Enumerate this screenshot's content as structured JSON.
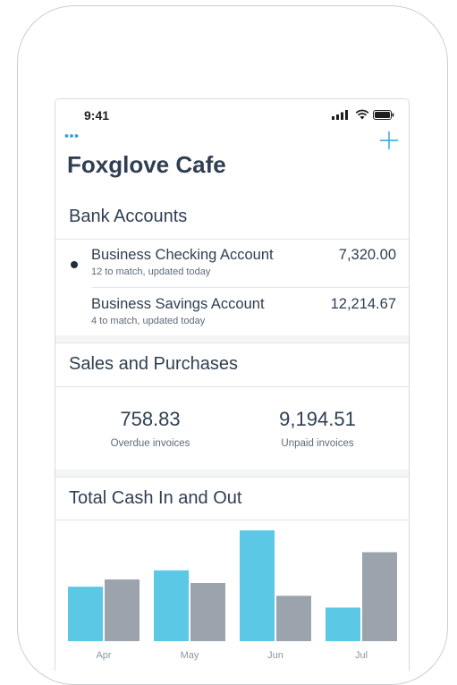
{
  "status_bar": {
    "time": "9:41"
  },
  "header": {
    "title": "Foxglove Cafe"
  },
  "bank_accounts": {
    "title": "Bank Accounts",
    "accounts": [
      {
        "name": "Business Checking Account",
        "subtitle": "12 to match, updated today",
        "amount": "7,320.00",
        "unread": true
      },
      {
        "name": "Business Savings Account",
        "subtitle": "4 to match, updated today",
        "amount": "12,214.67",
        "unread": false
      }
    ]
  },
  "sales_purchases": {
    "title": "Sales and Purchases",
    "overdue": {
      "value": "758.83",
      "label": "Overdue invoices"
    },
    "unpaid": {
      "value": "9,194.51",
      "label": "Unpaid invoices"
    }
  },
  "cash_chart": {
    "title": "Total Cash In and Out",
    "colors": {
      "cash_in": "#5bc8e6",
      "cash_out": "#9ba4ad",
      "accent": "#29a3de"
    }
  },
  "chart_data": {
    "type": "bar",
    "categories": [
      "Apr",
      "May",
      "Jun",
      "Jul"
    ],
    "series": [
      {
        "values": [
          60,
          78,
          122,
          37
        ]
      },
      {
        "values": [
          68,
          64,
          50,
          98
        ]
      }
    ],
    "ylim": [
      0,
      130
    ]
  }
}
